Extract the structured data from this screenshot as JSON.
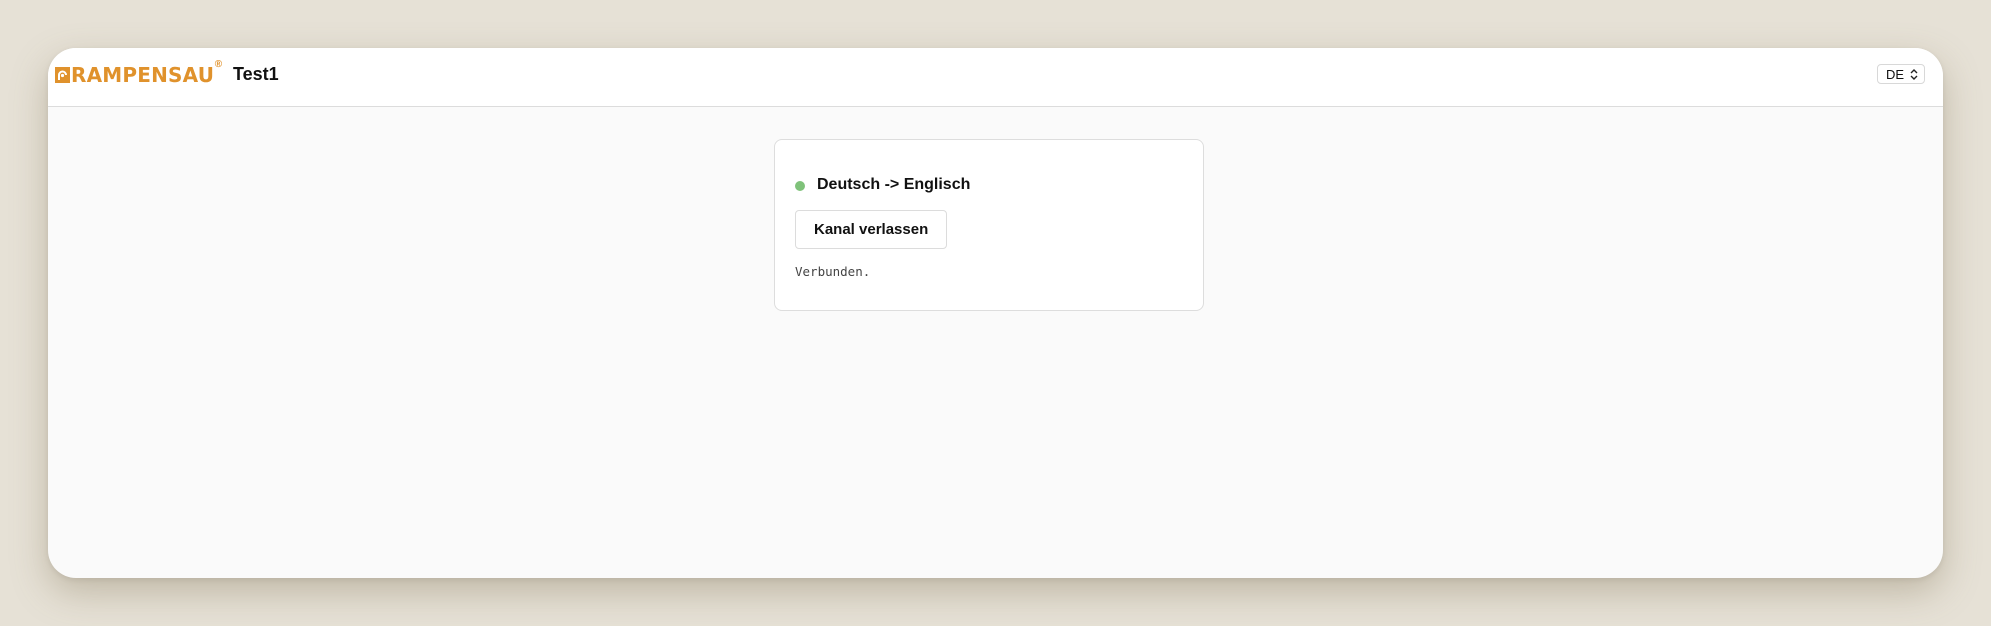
{
  "header": {
    "logo_text": "RAMPENSAU",
    "logo_registered": "®",
    "title": "Test1",
    "language": {
      "selected": "DE"
    }
  },
  "channel": {
    "title": "Deutsch -> Englisch",
    "status_color": "#7fc27a",
    "leave_label": "Kanal verlassen",
    "status_text": "Verbunden."
  },
  "colors": {
    "brand": "#e0922c",
    "background": "#e6e1d6",
    "connected": "#7fc27a"
  },
  "icons": {
    "logo_mark": "rampensau-logo-icon",
    "select_chevrons": "chevron-up-down-icon"
  }
}
